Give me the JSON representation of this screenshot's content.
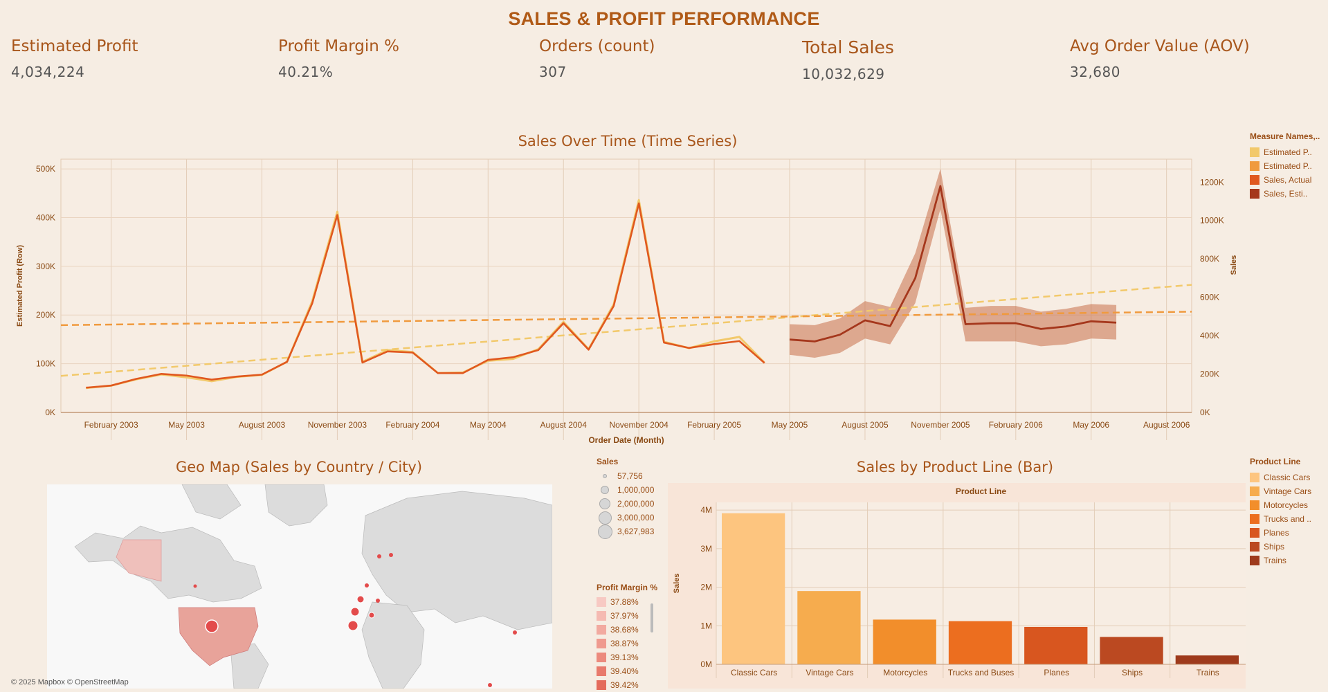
{
  "dashboard": {
    "title": "SALES & PROFIT PERFORMANCE"
  },
  "kpis": [
    {
      "label": "Estimated Profit",
      "value": "4,034,224"
    },
    {
      "label": "Profit Margin %",
      "value": "40.21%"
    },
    {
      "label": "Orders (count)",
      "value": "307"
    },
    {
      "label": "Total Sales",
      "value": "10,032,629"
    },
    {
      "label": "Avg Order Value (AOV)",
      "value": "32,680"
    }
  ],
  "time_series": {
    "title": "Sales Over Time (Time Series)",
    "xlabel": "Order Date (Month)",
    "ylabel_left": "Estimated Profit (Row)",
    "ylabel_right": "Sales",
    "left_ticks": [
      "0K",
      "100K",
      "200K",
      "300K",
      "400K",
      "500K"
    ],
    "right_ticks": [
      "0K",
      "200K",
      "400K",
      "600K",
      "800K",
      "1000K",
      "1200K"
    ],
    "x_ticks": [
      "February 2003",
      "May 2003",
      "August 2003",
      "November 2003",
      "February 2004",
      "May 2004",
      "August 2004",
      "November 2004",
      "February 2005",
      "May 2005",
      "August 2005",
      "November 2005",
      "February 2006",
      "May 2006",
      "August 2006"
    ],
    "legend_title": "Measure Names,..",
    "legend": [
      {
        "label": "Estimated P..",
        "color": "#f2c96b"
      },
      {
        "label": "Estimated P..",
        "color": "#f09a3e"
      },
      {
        "label": "Sales, Actual",
        "color": "#e0581f"
      },
      {
        "label": "Sales, Esti..",
        "color": "#a5371c"
      }
    ]
  },
  "geo_map": {
    "title": "Geo Map (Sales by Country / City)",
    "credit": "© 2025 Mapbox © OpenStreetMap",
    "size_legend_title": "Sales",
    "size_legend": [
      "57,756",
      "1,000,000",
      "2,000,000",
      "3,000,000",
      "3,627,983"
    ],
    "pm_legend_title": "Profit Margin %",
    "pm_legend": [
      {
        "label": "37.88%",
        "color": "#f7c9c3"
      },
      {
        "label": "37.97%",
        "color": "#f5bab2"
      },
      {
        "label": "38.68%",
        "color": "#f2aaa0"
      },
      {
        "label": "38.87%",
        "color": "#ef9a8f"
      },
      {
        "label": "39.13%",
        "color": "#ec8a7d"
      },
      {
        "label": "39.40%",
        "color": "#e87a6c"
      },
      {
        "label": "39.42%",
        "color": "#e46b5b"
      }
    ]
  },
  "product_line": {
    "title": "Sales by Product Line (Bar)",
    "header": "Product Line",
    "legend_title": "Product Line",
    "legend": [
      {
        "label": "Classic Cars",
        "color": "#fdc57f"
      },
      {
        "label": "Vintage Cars",
        "color": "#f6ac4e"
      },
      {
        "label": "Motorcycles",
        "color": "#f28e2b"
      },
      {
        "label": "Trucks and ..",
        "color": "#ec6e1f"
      },
      {
        "label": "Planes",
        "color": "#d8561f"
      },
      {
        "label": "Ships",
        "color": "#bb4921"
      },
      {
        "label": "Trains",
        "color": "#9e3a1c"
      }
    ]
  },
  "chart_data": [
    {
      "type": "line",
      "title": "Sales Over Time (Time Series)",
      "xlabel": "Order Date (Month)",
      "ylabel": "Estimated Profit (Row)",
      "y2label": "Sales",
      "x": [
        "2003-01",
        "2003-02",
        "2003-03",
        "2003-04",
        "2003-05",
        "2003-06",
        "2003-07",
        "2003-08",
        "2003-09",
        "2003-10",
        "2003-11",
        "2003-12",
        "2004-01",
        "2004-02",
        "2004-03",
        "2004-04",
        "2004-05",
        "2004-06",
        "2004-07",
        "2004-08",
        "2004-09",
        "2004-10",
        "2004-11",
        "2004-12",
        "2005-01",
        "2005-02",
        "2005-03",
        "2005-04",
        "2005-05"
      ],
      "ylim": [
        0,
        520000
      ],
      "y2lim": [
        0,
        1320000
      ],
      "series": [
        {
          "name": "Sales, Actual",
          "axis": "right",
          "values": [
            129000,
            140000,
            175000,
            201000,
            192000,
            171000,
            187000,
            197000,
            264000,
            568000,
            1029000,
            260000,
            318000,
            312000,
            205000,
            205000,
            274000,
            288000,
            325000,
            465000,
            327000,
            555000,
            1090000,
            364000,
            336000,
            356000,
            372000,
            258000,
            null
          ]
        },
        {
          "name": "Estimated P..",
          "axis": "left",
          "values": [
            50000,
            55000,
            68000,
            78000,
            72000,
            64000,
            73000,
            77000,
            104000,
            228000,
            412000,
            104000,
            128000,
            124000,
            81000,
            82000,
            106000,
            110000,
            130000,
            186000,
            130000,
            222000,
            436000,
            145000,
            132000,
            146000,
            155000,
            102000,
            null
          ]
        },
        {
          "name": "Sales, Esti..",
          "axis": "right",
          "x": [
            "2005-05",
            "2005-06",
            "2005-07",
            "2005-08",
            "2005-09",
            "2005-10",
            "2005-11",
            "2005-12",
            "2006-01",
            "2006-02",
            "2006-03",
            "2006-04",
            "2006-05",
            "2006-06"
          ],
          "values": [
            380000,
            370000,
            405000,
            480000,
            450000,
            700000,
            1180000,
            460000,
            465000,
            465000,
            435000,
            448000,
            475000,
            468000
          ],
          "band_low": [
            300000,
            285000,
            310000,
            385000,
            355000,
            570000,
            1060000,
            370000,
            370000,
            370000,
            345000,
            355000,
            385000,
            380000
          ],
          "band_high": [
            460000,
            455000,
            490000,
            580000,
            550000,
            830000,
            1270000,
            545000,
            555000,
            555000,
            525000,
            540000,
            565000,
            560000
          ]
        },
        {
          "name": "Estimated P.. (trend)",
          "axis": "left",
          "x": [
            "2002-12",
            "2006-09"
          ],
          "values": [
            75000,
            262000
          ]
        },
        {
          "name": "Sales trend",
          "axis": "right",
          "x": [
            "2002-12",
            "2006-09"
          ],
          "values": [
            455000,
            525000
          ]
        }
      ]
    },
    {
      "type": "bar",
      "title": "Sales by Product Line (Bar)",
      "xlabel": "Product Line",
      "ylabel": "Sales",
      "categories": [
        "Classic Cars",
        "Vintage Cars",
        "Motorcycles",
        "Trucks and Buses",
        "Planes",
        "Ships",
        "Trains"
      ],
      "values": [
        3920000,
        1900000,
        1160000,
        1120000,
        970000,
        710000,
        230000
      ],
      "ylim": [
        0,
        4200000
      ],
      "yticks": [
        "0M",
        "1M",
        "2M",
        "3M",
        "4M"
      ]
    }
  ]
}
